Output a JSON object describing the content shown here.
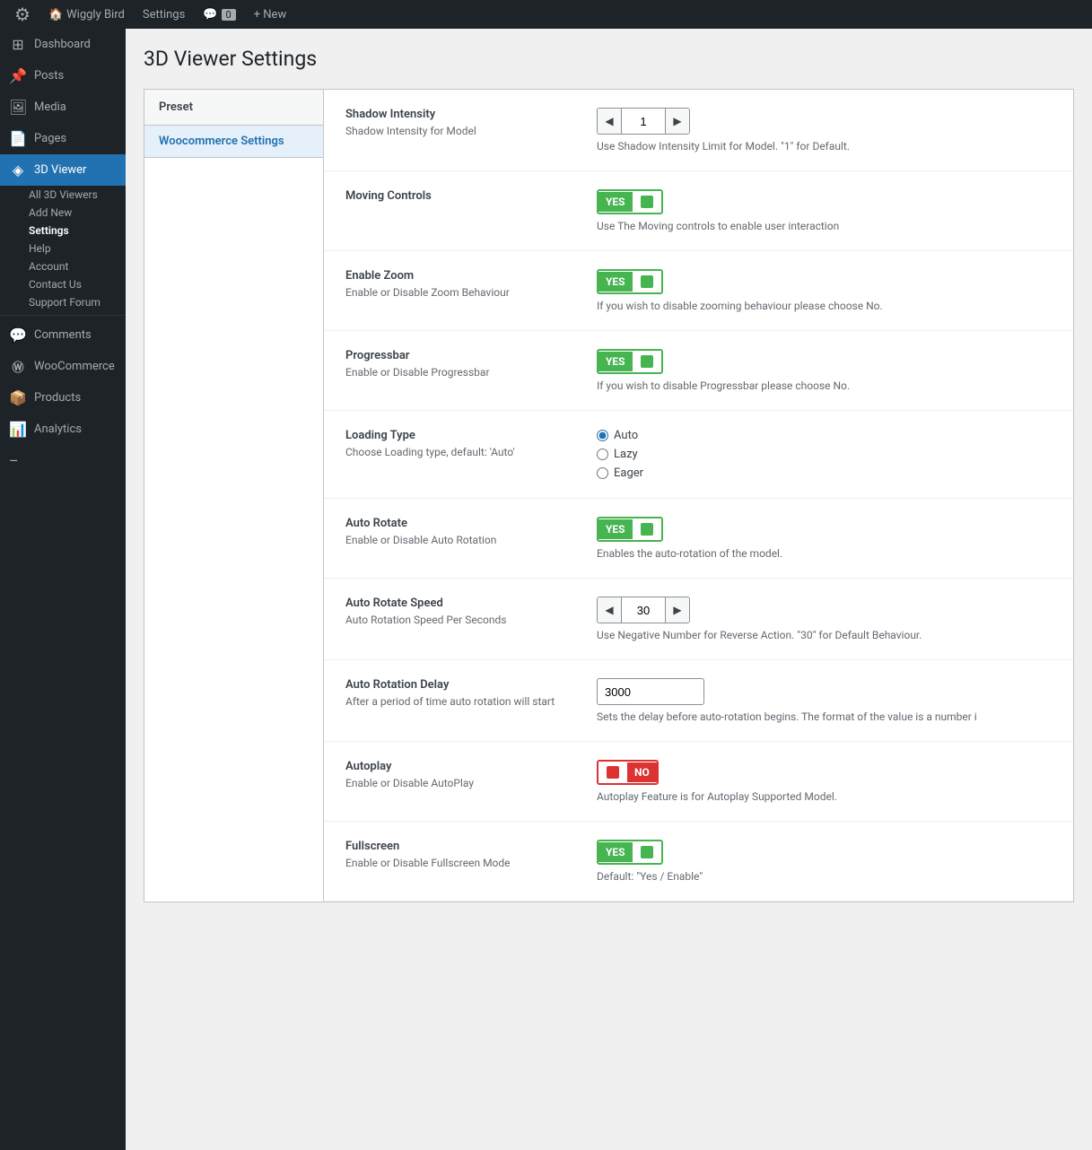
{
  "adminBar": {
    "logo": "⚙",
    "siteName": "Wiggly Bird",
    "settings": "Settings",
    "commentIcon": "💬",
    "commentCount": "0",
    "newLabel": "+ New"
  },
  "sidebar": {
    "items": [
      {
        "id": "dashboard",
        "icon": "⊞",
        "label": "Dashboard"
      },
      {
        "id": "posts",
        "icon": "📌",
        "label": "Posts"
      },
      {
        "id": "media",
        "icon": "🖼",
        "label": "Media"
      },
      {
        "id": "pages",
        "icon": "📄",
        "label": "Pages"
      },
      {
        "id": "3d-viewer",
        "icon": "◈",
        "label": "3D Viewer",
        "active": true
      },
      {
        "id": "comments",
        "icon": "💬",
        "label": "Comments"
      },
      {
        "id": "woocommerce",
        "icon": "Ⓦ",
        "label": "WooCommerce"
      },
      {
        "id": "products",
        "icon": "📦",
        "label": "Products"
      },
      {
        "id": "analytics",
        "icon": "📊",
        "label": "Analytics"
      }
    ],
    "subItems3DViewer": [
      {
        "id": "all-3d-viewers",
        "label": "All 3D Viewers"
      },
      {
        "id": "add-new",
        "label": "Add New"
      },
      {
        "id": "settings",
        "label": "Settings",
        "active": true
      },
      {
        "id": "help",
        "label": "Help"
      },
      {
        "id": "account",
        "label": "Account"
      },
      {
        "id": "contact-us",
        "label": "Contact Us"
      },
      {
        "id": "support-forum",
        "label": "Support Forum"
      }
    ]
  },
  "pageTitle": "3D Viewer Settings",
  "presetPanel": {
    "header": "Preset",
    "items": [
      {
        "id": "woocommerce-settings",
        "label": "Woocommerce Settings",
        "active": true
      }
    ]
  },
  "settings": [
    {
      "id": "shadow-intensity",
      "label": "Shadow Intensity",
      "desc": "Shadow Intensity for Model",
      "type": "number",
      "value": "1",
      "hint": "Use Shadow Intensity Limit for Model. \"1\" for Default."
    },
    {
      "id": "moving-controls",
      "label": "Moving Controls",
      "desc": "Use The Moving controls to enable user interaction",
      "type": "toggle",
      "value": true,
      "hint": "Use The Moving controls to enable user interaction"
    },
    {
      "id": "enable-zoom",
      "label": "Enable Zoom",
      "desc": "Enable or Disable Zoom Behaviour",
      "type": "toggle",
      "value": true,
      "hint": "If you wish to disable zooming behaviour please choose No."
    },
    {
      "id": "progressbar",
      "label": "Progressbar",
      "desc": "Enable or Disable Progressbar",
      "type": "toggle",
      "value": true,
      "hint": "If you wish to disable Progressbar please choose No."
    },
    {
      "id": "loading-type",
      "label": "Loading Type",
      "desc": "Choose Loading type, default: 'Auto'",
      "type": "radio",
      "options": [
        "Auto",
        "Lazy",
        "Eager"
      ],
      "value": "Auto",
      "hint": ""
    },
    {
      "id": "auto-rotate",
      "label": "Auto Rotate",
      "desc": "Enable or Disable Auto Rotation",
      "type": "toggle",
      "value": true,
      "hint": "Enables the auto-rotation of the model."
    },
    {
      "id": "auto-rotate-speed",
      "label": "Auto Rotate Speed",
      "desc": "Auto Rotation Speed Per Seconds",
      "type": "number",
      "value": "30",
      "hint": "Use Negative Number for Reverse Action. \"30\" for Default Behaviour."
    },
    {
      "id": "auto-rotation-delay",
      "label": "Auto Rotation Delay",
      "desc": "After a period of time auto rotation will start",
      "type": "text",
      "value": "3000",
      "hint": "Sets the delay before auto-rotation begins. The format of the value is a number i"
    },
    {
      "id": "autoplay",
      "label": "Autoplay",
      "desc": "Enable or Disable AutoPlay",
      "type": "toggle",
      "value": false,
      "hint": "Autoplay Feature is for Autoplay Supported Model."
    },
    {
      "id": "fullscreen",
      "label": "Fullscreen",
      "desc": "Enable or Disable Fullscreen Mode",
      "type": "toggle",
      "value": true,
      "hint": "Default: \"Yes / Enable\""
    }
  ],
  "toggleLabels": {
    "yes": "YES",
    "no": "NO"
  }
}
